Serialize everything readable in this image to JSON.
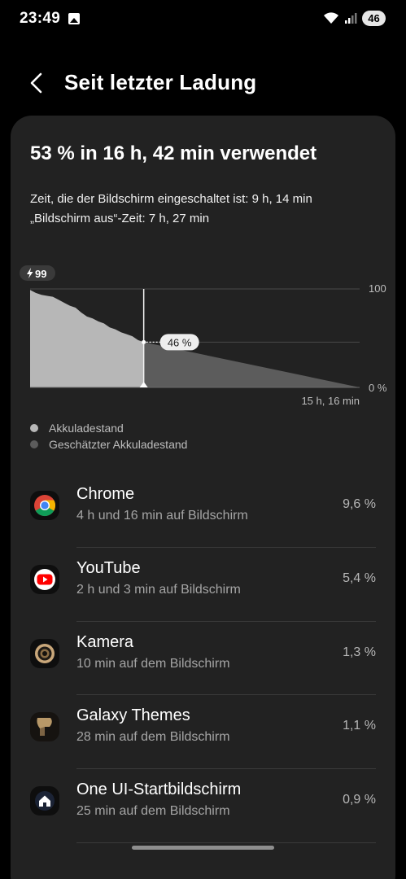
{
  "status_bar": {
    "time": "23:49",
    "battery": "46",
    "icons": [
      "gallery-icon",
      "wifi-icon",
      "signal-icon",
      "battery-icon"
    ]
  },
  "header": {
    "back_icon": "chevron-left-icon",
    "title": "Seit letzter Ladung"
  },
  "summary": {
    "title": "53 % in 16 h, 42 min verwendet",
    "screen_on": "Zeit, die der Bildschirm eingeschaltet ist: 9 h, 14 min",
    "screen_off": "„Bildschirm aus“-Zeit: 7 h, 27 min"
  },
  "chart_data": {
    "type": "area",
    "start_badge": "99",
    "current_label": "46 %",
    "y_tick_labels": [
      "100",
      "0 %"
    ],
    "ylim": [
      0,
      100
    ],
    "x_end_label": "15 h, 16 min",
    "series": [
      {
        "name": "Akkuladestand",
        "color": "#b7b7b7",
        "x": [
          0.0,
          0.05,
          0.1,
          0.15,
          0.2,
          0.25,
          0.3,
          0.35,
          0.4,
          0.45,
          0.5,
          0.55,
          0.6,
          0.65,
          0.7,
          0.75,
          0.8,
          0.85,
          0.9,
          0.95,
          1.0
        ],
        "values": [
          99,
          96,
          94,
          93,
          92,
          89,
          86,
          83,
          81,
          76,
          72,
          70,
          67,
          65,
          61,
          59,
          56,
          54,
          52,
          48,
          46
        ]
      },
      {
        "name": "Geschätzter Akkuladestand",
        "color": "#5c5c5c",
        "x": [
          1.0,
          2.9
        ],
        "values": [
          46,
          0
        ]
      }
    ]
  },
  "legend": {
    "actual": "Akkuladestand",
    "estimated": "Geschätzter Akkuladestand",
    "actual_color": "#b7b7b7",
    "estimated_color": "#5c5c5c"
  },
  "apps": [
    {
      "name": "Chrome",
      "usage": "4 h und 16 min auf Bildschirm",
      "percent": "9,6 %",
      "icon": "chrome-icon"
    },
    {
      "name": "YouTube",
      "usage": "2 h und 3 min auf Bildschirm",
      "percent": "5,4 %",
      "icon": "youtube-icon"
    },
    {
      "name": "Kamera",
      "usage": "10 min auf dem Bildschirm",
      "percent": "1,3 %",
      "icon": "camera-icon"
    },
    {
      "name": "Galaxy Themes",
      "usage": "28 min auf dem Bildschirm",
      "percent": "1,1 %",
      "icon": "themes-icon"
    },
    {
      "name": "One UI-Startbildschirm",
      "usage": "25 min auf dem Bildschirm",
      "percent": "0,9 %",
      "icon": "home-icon"
    }
  ]
}
